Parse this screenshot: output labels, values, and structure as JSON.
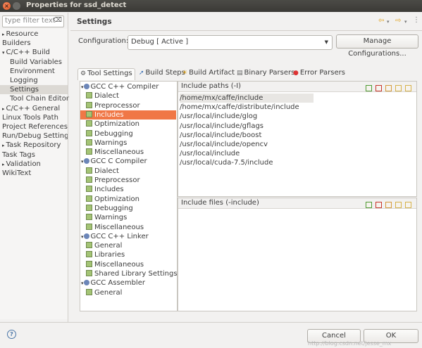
{
  "window": {
    "title": "Properties for ssd_detect"
  },
  "filter": {
    "placeholder": "type filter text"
  },
  "nav": [
    {
      "label": "Resource",
      "arrow": "▸",
      "indent": 0
    },
    {
      "label": "Builders",
      "arrow": "",
      "indent": 0
    },
    {
      "label": "C/C++ Build",
      "arrow": "▾",
      "indent": 0
    },
    {
      "label": "Build Variables",
      "arrow": "",
      "indent": 1
    },
    {
      "label": "Environment",
      "arrow": "",
      "indent": 1
    },
    {
      "label": "Logging",
      "arrow": "",
      "indent": 1
    },
    {
      "label": "Settings",
      "arrow": "",
      "indent": 1,
      "selected": true
    },
    {
      "label": "Tool Chain Editor",
      "arrow": "",
      "indent": 1
    },
    {
      "label": "C/C++ General",
      "arrow": "▸",
      "indent": 0
    },
    {
      "label": "Linux Tools Path",
      "arrow": "",
      "indent": 0
    },
    {
      "label": "Project References",
      "arrow": "",
      "indent": 0
    },
    {
      "label": "Run/Debug Setting",
      "arrow": "",
      "indent": 0
    },
    {
      "label": "Task Repository",
      "arrow": "▸",
      "indent": 0
    },
    {
      "label": "Task Tags",
      "arrow": "",
      "indent": 0
    },
    {
      "label": "Validation",
      "arrow": "▸",
      "indent": 0
    },
    {
      "label": "WikiText",
      "arrow": "",
      "indent": 0
    }
  ],
  "header": {
    "title": "Settings"
  },
  "configuration": {
    "label": "Configuration:",
    "value": "Debug  [ Active ]",
    "manage_label": "Manage Configurations..."
  },
  "tabs": [
    {
      "label": "Tool Settings",
      "icon": "tool-settings-icon",
      "glyph": "⚙",
      "color": "#555"
    },
    {
      "label": "Build Steps",
      "icon": "build-steps-icon",
      "glyph": "➚",
      "color": "#3a6fb3"
    },
    {
      "label": "Build Artifact",
      "icon": "build-artifact-icon",
      "glyph": "☀",
      "color": "#d69b16"
    },
    {
      "label": "Binary Parsers",
      "icon": "binary-parsers-icon",
      "glyph": "▤",
      "color": "#666"
    },
    {
      "label": "Error Parsers",
      "icon": "error-parsers-icon",
      "glyph": "●",
      "color": "#d33"
    }
  ],
  "tool_tree": [
    {
      "label": "GCC C++ Compiler",
      "type": "compiler"
    },
    {
      "label": "Dialect",
      "type": "option"
    },
    {
      "label": "Preprocessor",
      "type": "option"
    },
    {
      "label": "Includes",
      "type": "option",
      "selected": true
    },
    {
      "label": "Optimization",
      "type": "option"
    },
    {
      "label": "Debugging",
      "type": "option"
    },
    {
      "label": "Warnings",
      "type": "option"
    },
    {
      "label": "Miscellaneous",
      "type": "option"
    },
    {
      "label": "GCC C Compiler",
      "type": "compiler"
    },
    {
      "label": "Dialect",
      "type": "option"
    },
    {
      "label": "Preprocessor",
      "type": "option"
    },
    {
      "label": "Includes",
      "type": "option"
    },
    {
      "label": "Optimization",
      "type": "option"
    },
    {
      "label": "Debugging",
      "type": "option"
    },
    {
      "label": "Warnings",
      "type": "option"
    },
    {
      "label": "Miscellaneous",
      "type": "option"
    },
    {
      "label": "GCC C++ Linker",
      "type": "compiler"
    },
    {
      "label": "General",
      "type": "option"
    },
    {
      "label": "Libraries",
      "type": "option"
    },
    {
      "label": "Miscellaneous",
      "type": "option"
    },
    {
      "label": "Shared Library Settings",
      "type": "option"
    },
    {
      "label": "GCC Assembler",
      "type": "compiler"
    },
    {
      "label": "General",
      "type": "option"
    }
  ],
  "include_paths": {
    "title": "Include paths (-I)",
    "items": [
      "/home/mx/caffe/include",
      "/home/mx/caffe/distribute/include",
      "/usr/local/include/glog",
      "/usr/local/include/gflags",
      "/usr/local/include/boost",
      "/usr/local/include/opencv",
      "/usr/local/include",
      "/usr/local/cuda-7.5/include"
    ]
  },
  "include_files": {
    "title": "Include files (-include)",
    "items": []
  },
  "panel_tools": [
    "add-icon",
    "delete-icon",
    "edit-icon",
    "move-up-icon",
    "move-down-icon"
  ],
  "footer": {
    "cancel_label": "Cancel",
    "ok_label": "OK"
  },
  "watermark": "http://blog.csdn.net/jesse_mx"
}
